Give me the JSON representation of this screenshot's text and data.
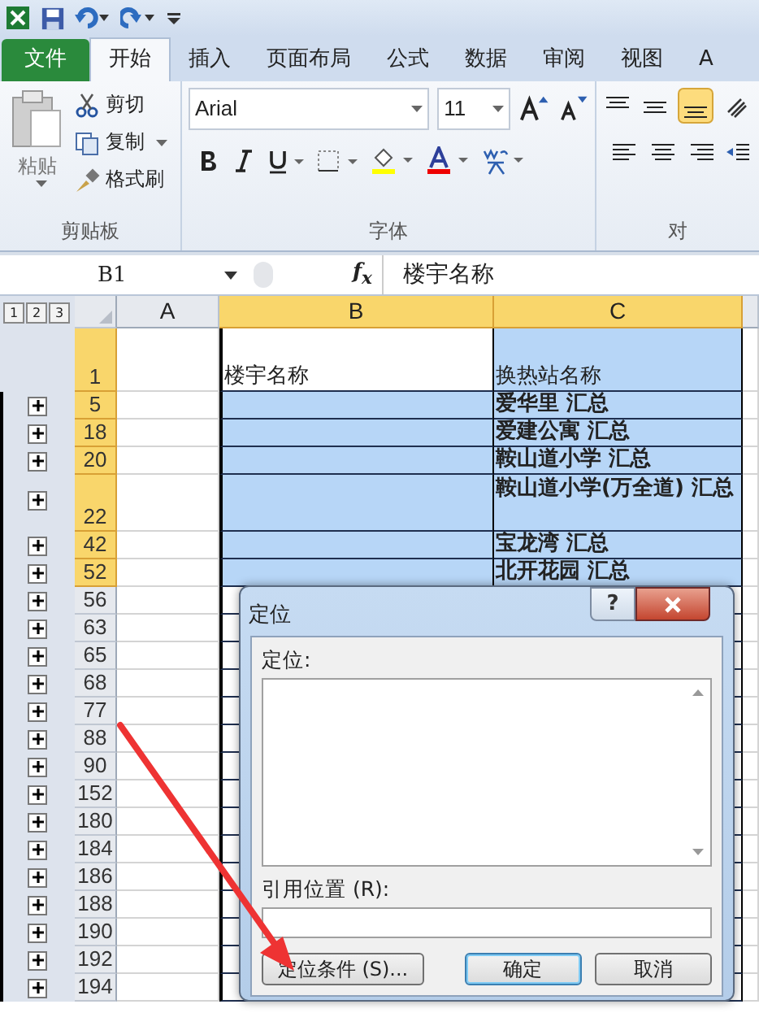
{
  "tabs": [
    {
      "label": "文件",
      "kind": "file",
      "selected": false
    },
    {
      "label": "开始",
      "kind": "tab",
      "selected": true
    },
    {
      "label": "插入",
      "kind": "tab",
      "selected": false
    },
    {
      "label": "页面布局",
      "kind": "tab",
      "selected": false
    },
    {
      "label": "公式",
      "kind": "tab",
      "selected": false
    },
    {
      "label": "数据",
      "kind": "tab",
      "selected": false
    },
    {
      "label": "审阅",
      "kind": "tab",
      "selected": false
    },
    {
      "label": "视图",
      "kind": "tab",
      "selected": false
    },
    {
      "label": "A",
      "kind": "tab",
      "selected": false
    }
  ],
  "ribbon": {
    "clipboard": {
      "paste": "粘贴",
      "cut": "剪切",
      "copy": "复制",
      "painter": "格式刷",
      "label": "剪贴板"
    },
    "font": {
      "name": "Arial",
      "size": "11",
      "label": "字体"
    },
    "alignment": {
      "label": "对"
    }
  },
  "formula_bar": {
    "name_box": "B1",
    "fx": "f$_{x}$",
    "value": "楼宇名称"
  },
  "outline_levels": [
    "1",
    "2",
    "3"
  ],
  "columns": [
    {
      "label": "A",
      "selected": false
    },
    {
      "label": "B",
      "selected": true
    },
    {
      "label": "C",
      "selected": true
    }
  ],
  "rows": [
    {
      "kind": "header",
      "number": "1",
      "b": "楼宇名称",
      "c": "换热站名称",
      "selected": true,
      "collapsed": false
    },
    {
      "kind": "total",
      "number": "5",
      "c": "爱华里 汇总",
      "selected": true,
      "collapsed": true
    },
    {
      "kind": "total",
      "number": "18",
      "c": "爱建公寓 汇总",
      "selected": true,
      "collapsed": true
    },
    {
      "kind": "total",
      "number": "20",
      "c": "鞍山道小学 汇总",
      "selected": true,
      "collapsed": true
    },
    {
      "kind": "total",
      "number": "22",
      "c": "鞍山道小学(万全道) 汇总",
      "selected": true,
      "collapsed": true
    },
    {
      "kind": "total",
      "number": "42",
      "c": "宝龙湾 汇总",
      "selected": true,
      "collapsed": true
    },
    {
      "kind": "total",
      "number": "52",
      "c": "北开花园 汇总",
      "selected": true,
      "collapsed": true
    },
    {
      "kind": "total",
      "number": "56",
      "selected": false,
      "collapsed": true
    },
    {
      "kind": "total",
      "number": "63",
      "selected": false,
      "collapsed": true
    },
    {
      "kind": "total",
      "number": "65",
      "selected": false,
      "collapsed": true
    },
    {
      "kind": "total",
      "number": "68",
      "selected": false,
      "collapsed": true
    },
    {
      "kind": "total",
      "number": "77",
      "selected": false,
      "collapsed": true
    },
    {
      "kind": "total",
      "number": "88",
      "selected": false,
      "collapsed": true
    },
    {
      "kind": "total",
      "number": "90",
      "selected": false,
      "collapsed": true
    },
    {
      "kind": "total",
      "number": "152",
      "selected": false,
      "collapsed": true
    },
    {
      "kind": "total",
      "number": "180",
      "selected": false,
      "collapsed": true
    },
    {
      "kind": "total",
      "number": "184",
      "selected": false,
      "collapsed": true
    },
    {
      "kind": "total",
      "number": "186",
      "selected": false,
      "collapsed": true
    },
    {
      "kind": "total",
      "number": "188",
      "selected": false,
      "collapsed": true
    },
    {
      "kind": "total",
      "number": "190",
      "selected": false,
      "collapsed": true
    },
    {
      "kind": "total",
      "number": "192",
      "selected": false,
      "collapsed": true
    },
    {
      "kind": "total",
      "number": "194",
      "selected": false,
      "collapsed": true
    }
  ],
  "dialog": {
    "title": "定位",
    "help": "?",
    "list_label": "定位:",
    "ref_label": "引用位置 (R):",
    "buttons": [
      {
        "label": "定位条件 (S)...",
        "kind": "special"
      },
      {
        "label": "确定",
        "kind": "default"
      },
      {
        "label": "取消",
        "kind": "normal"
      }
    ]
  }
}
